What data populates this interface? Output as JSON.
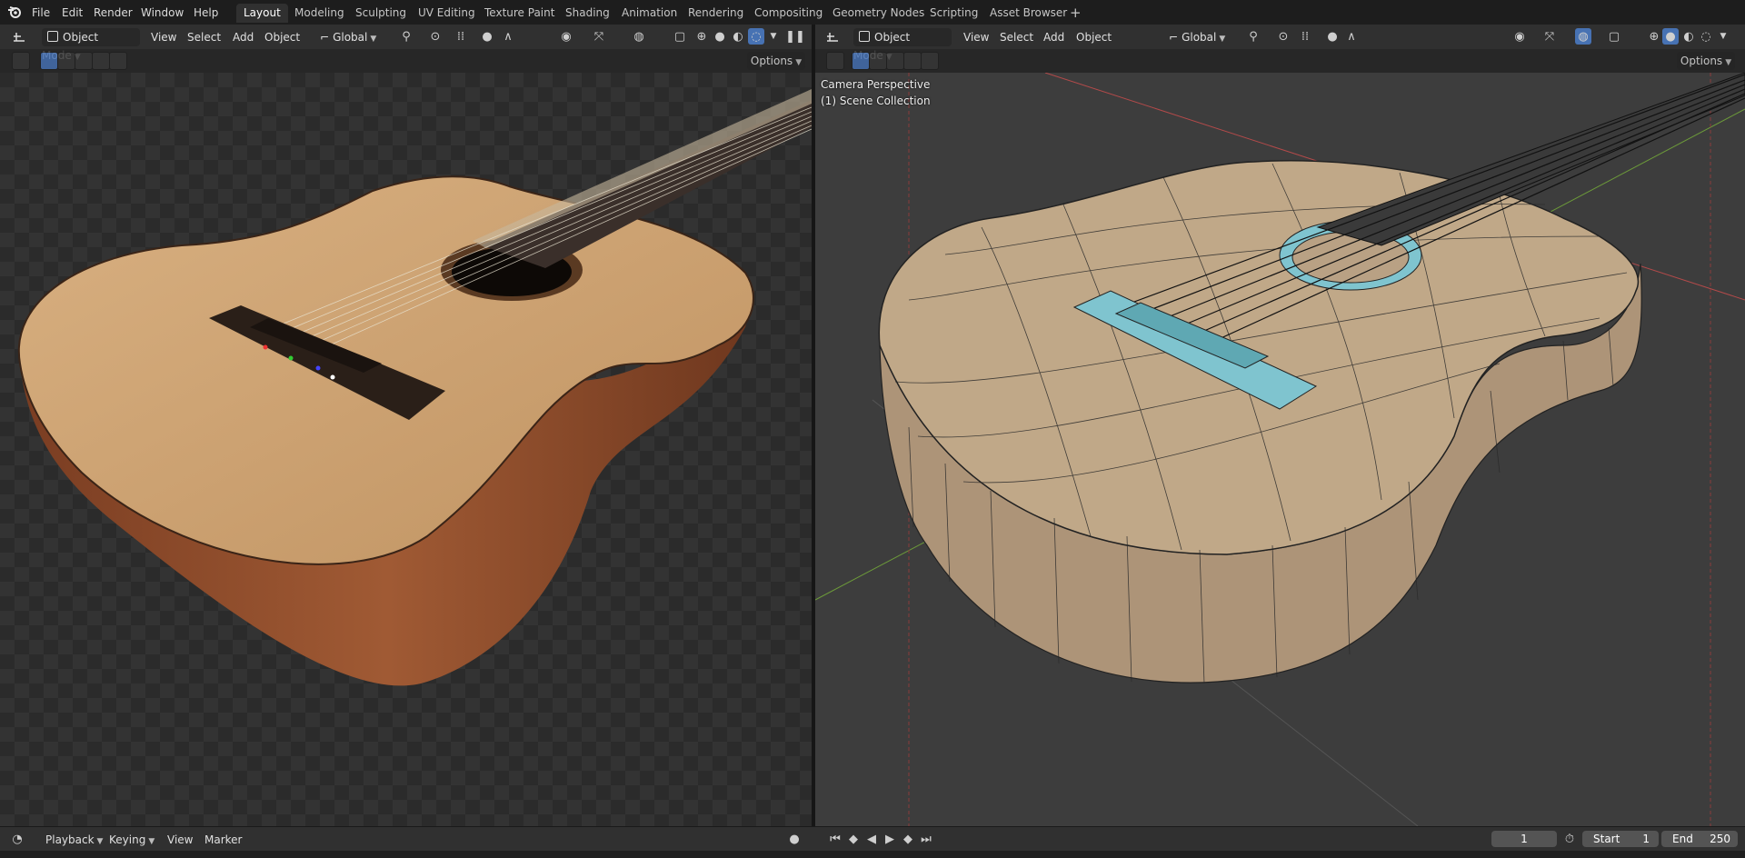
{
  "menu": {
    "file": "File",
    "edit": "Edit",
    "render": "Render",
    "window": "Window",
    "help": "Help"
  },
  "workspaces": [
    "Layout",
    "Modeling",
    "Sculpting",
    "UV Editing",
    "Texture Paint",
    "Shading",
    "Animation",
    "Rendering",
    "Compositing",
    "Geometry Nodes",
    "Scripting",
    "Asset Browser"
  ],
  "workspace_add": "+",
  "left_header": {
    "mode": "Object Mode",
    "view": "View",
    "select": "Select",
    "add": "Add",
    "object": "Object",
    "orientation": "Global",
    "options": "Options"
  },
  "right_header": {
    "mode": "Object Mode",
    "view": "View",
    "select": "Select",
    "add": "Add",
    "object": "Object",
    "orientation": "Global",
    "options": "Options"
  },
  "right_viewport": {
    "line1": "Camera Perspective",
    "line2": "(1) Scene Collection"
  },
  "timeline": {
    "playback": "Playback",
    "keying": "Keying",
    "view": "View",
    "marker": "Marker",
    "current_frame": "1",
    "start_label": "Start",
    "start": "1",
    "end_label": "End",
    "end": "250"
  },
  "colors": {
    "accent": "#4772b3",
    "active_tab": "#303030",
    "header": "#303030",
    "viewport_bg": "#3a3a3a",
    "wood_top": "#cfa577",
    "wood_side": "#8a4a2a",
    "mesh_tan": "#b49c80",
    "mesh_cyan": "#7fc4cf"
  },
  "icons": [
    "blender-logo-icon",
    "editor-type-icon",
    "object-mode-icon",
    "transform-orientation-icon",
    "pivot-icon",
    "snap-icon",
    "proportional-icon",
    "visibility-icon",
    "gizmo-icon",
    "overlay-icon",
    "xray-icon",
    "wireframe-shading-icon",
    "solid-shading-icon",
    "material-shading-icon",
    "rendered-shading-icon",
    "pause-icon",
    "select-box-icon",
    "play-icon",
    "jump-start-icon",
    "jump-end-icon",
    "keyframe-prev-icon",
    "keyframe-next-icon",
    "record-icon",
    "clock-icon"
  ]
}
